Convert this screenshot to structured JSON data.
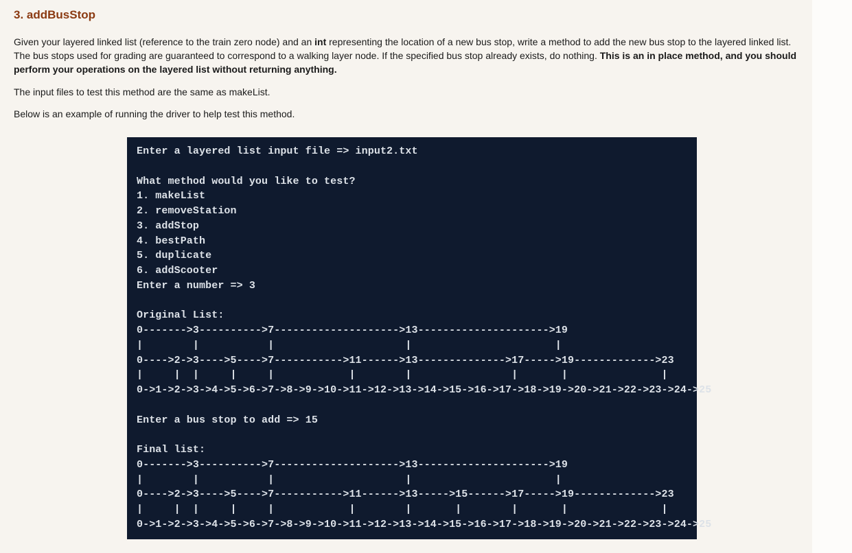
{
  "heading": "3. addBusStop",
  "intro": {
    "seg1": "Given your layered linked list (reference to the train zero node) and an ",
    "bold1": "int",
    "seg2": " representing the location of a new bus stop, write a method to add the new bus stop to the layered linked list. The bus stops used for grading are guaranteed to correspond to a walking layer node. If the specified bus stop already exists, do nothing. ",
    "bold2": "This is an in place method, and you should perform your operations on the layered list without returning anything."
  },
  "para2": "The input files to test this method are the same as makeList.",
  "para3": "Below is an example of running the driver to help test this method.",
  "terminal_lines": [
    "Enter a layered list input file => input2.txt",
    "",
    "What method would you like to test?",
    "1. makeList",
    "2. removeStation",
    "3. addStop",
    "4. bestPath",
    "5. duplicate",
    "6. addScooter",
    "Enter a number => 3",
    "",
    "Original List:",
    "0------->3---------->7-------------------->13--------------------->19",
    "|        |           |                     |                       |",
    "0---->2->3---->5---->7----------->11------>13-------------->17----->19------------->23",
    "|     |  |     |     |            |        |                |       |               |",
    "0->1->2->3->4->5->6->7->8->9->10->11->12->13->14->15->16->17->18->19->20->21->22->23->24->25",
    "",
    "Enter a bus stop to add => 15",
    "",
    "Final list:",
    "0------->3---------->7-------------------->13--------------------->19",
    "|        |           |                     |                       |",
    "0---->2->3---->5---->7----------->11------>13----->15------>17----->19------------->23",
    "|     |  |     |     |            |        |       |        |       |               |",
    "0->1->2->3->4->5->6->7->8->9->10->11->12->13->14->15->16->17->18->19->20->21->22->23->24->25"
  ]
}
